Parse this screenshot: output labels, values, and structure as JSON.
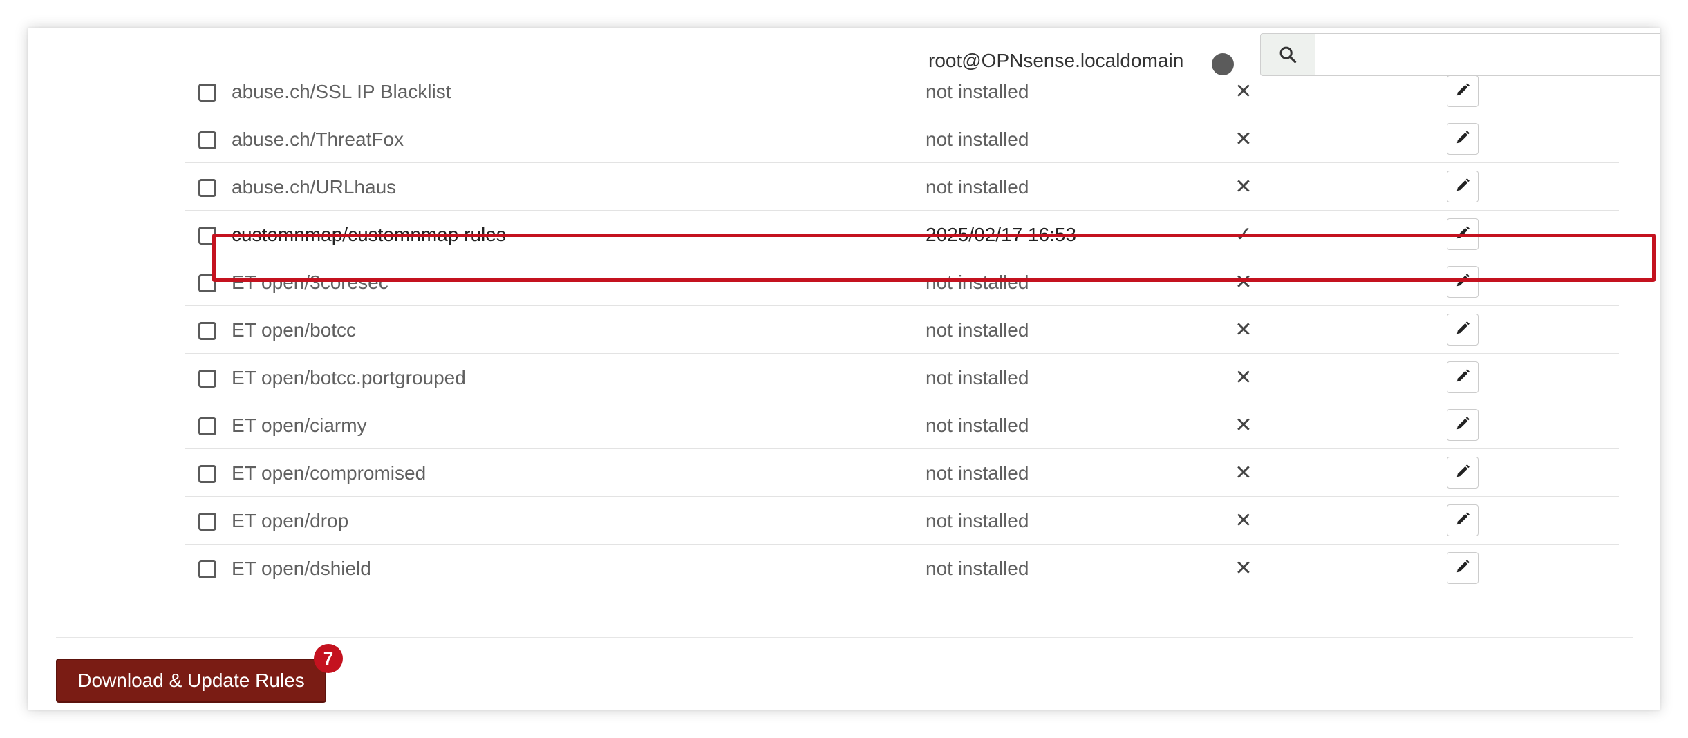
{
  "header": {
    "user": "root@OPNsense.localdomain",
    "search": {
      "placeholder": "",
      "value": ""
    }
  },
  "rules": [
    {
      "name": "abuse.ch/SSL IP Blacklist",
      "last_updated": "not installed",
      "enabled": "✕",
      "selected": false
    },
    {
      "name": "abuse.ch/ThreatFox",
      "last_updated": "not installed",
      "enabled": "✕",
      "selected": false
    },
    {
      "name": "abuse.ch/URLhaus",
      "last_updated": "not installed",
      "enabled": "✕",
      "selected": false
    },
    {
      "name": "customnmap/customnmap rules",
      "last_updated": "2025/02/17 16:53",
      "enabled": "✓",
      "selected": true
    },
    {
      "name": "ET open/3coresec",
      "last_updated": "not installed",
      "enabled": "✕",
      "selected": false
    },
    {
      "name": "ET open/botcc",
      "last_updated": "not installed",
      "enabled": "✕",
      "selected": false
    },
    {
      "name": "ET open/botcc.portgrouped",
      "last_updated": "not installed",
      "enabled": "✕",
      "selected": false
    },
    {
      "name": "ET open/ciarmy",
      "last_updated": "not installed",
      "enabled": "✕",
      "selected": false
    },
    {
      "name": "ET open/compromised",
      "last_updated": "not installed",
      "enabled": "✕",
      "selected": false
    },
    {
      "name": "ET open/drop",
      "last_updated": "not installed",
      "enabled": "✕",
      "selected": false
    },
    {
      "name": "ET open/dshield",
      "last_updated": "not installed",
      "enabled": "✕",
      "selected": false
    }
  ],
  "footer": {
    "download_label": "Download & Update Rules",
    "badge": "7"
  },
  "colors": {
    "button": "#7a1c14",
    "highlight": "#c4121f",
    "status_dot": "#5b5b5b"
  },
  "icons": {
    "search": "search-icon",
    "edit": "pencil-icon",
    "enabled_no": "x-icon",
    "enabled_yes": "check-icon"
  }
}
